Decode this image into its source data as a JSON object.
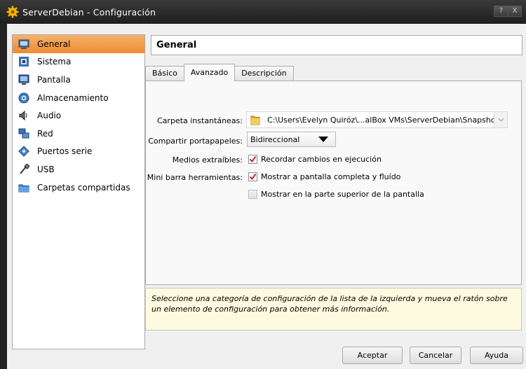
{
  "window": {
    "title": "ServerDebian - Configuración",
    "help_btn": "?",
    "close_btn": "X"
  },
  "sidebar": {
    "items": [
      {
        "label": "General",
        "icon": "monitor-icon"
      },
      {
        "label": "Sistema",
        "icon": "chip-icon"
      },
      {
        "label": "Pantalla",
        "icon": "display-icon"
      },
      {
        "label": "Almacenamiento",
        "icon": "disk-icon"
      },
      {
        "label": "Audio",
        "icon": "speaker-icon"
      },
      {
        "label": "Red",
        "icon": "network-icon"
      },
      {
        "label": "Puertos serie",
        "icon": "serial-port-icon"
      },
      {
        "label": "USB",
        "icon": "usb-icon"
      },
      {
        "label": "Carpetas compartidas",
        "icon": "folder-icon"
      }
    ],
    "selected": "General"
  },
  "header": {
    "title": "General"
  },
  "tabs": [
    {
      "label": "Básico"
    },
    {
      "label": "Avanzado"
    },
    {
      "label": "Descripción"
    }
  ],
  "active_tab": "Avanzado",
  "form": {
    "snapshot_label": "Carpeta instantáneas:",
    "snapshot_path": "C:\\Users\\Evelyn Quiróz\\...alBox VMs\\ServerDebian\\Snapshots",
    "clipboard_label": "Compartir portapapeles:",
    "clipboard_value": "Bidireccional",
    "removable_label": "Medios extraíbles:",
    "removable_check": "Recordar cambios en ejecución",
    "minibar_label": "Mini barra herramientas:",
    "minibar_check1": "Mostrar a pantalla completa y fluído",
    "minibar_check2": "Mostrar en la parte superior de la pantalla"
  },
  "info": {
    "text": "Seleccione una categoría de configuración de la lista de la izquierda y mueva el ratón sobre un elemento de configuración para obtener más información."
  },
  "buttons": {
    "ok": "Aceptar",
    "cancel": "Cancelar",
    "help": "Ayuda"
  },
  "colors": {
    "selection": "#ee8c33",
    "info_bg": "#fdfadf",
    "titlebar": "#1e1e1e"
  }
}
